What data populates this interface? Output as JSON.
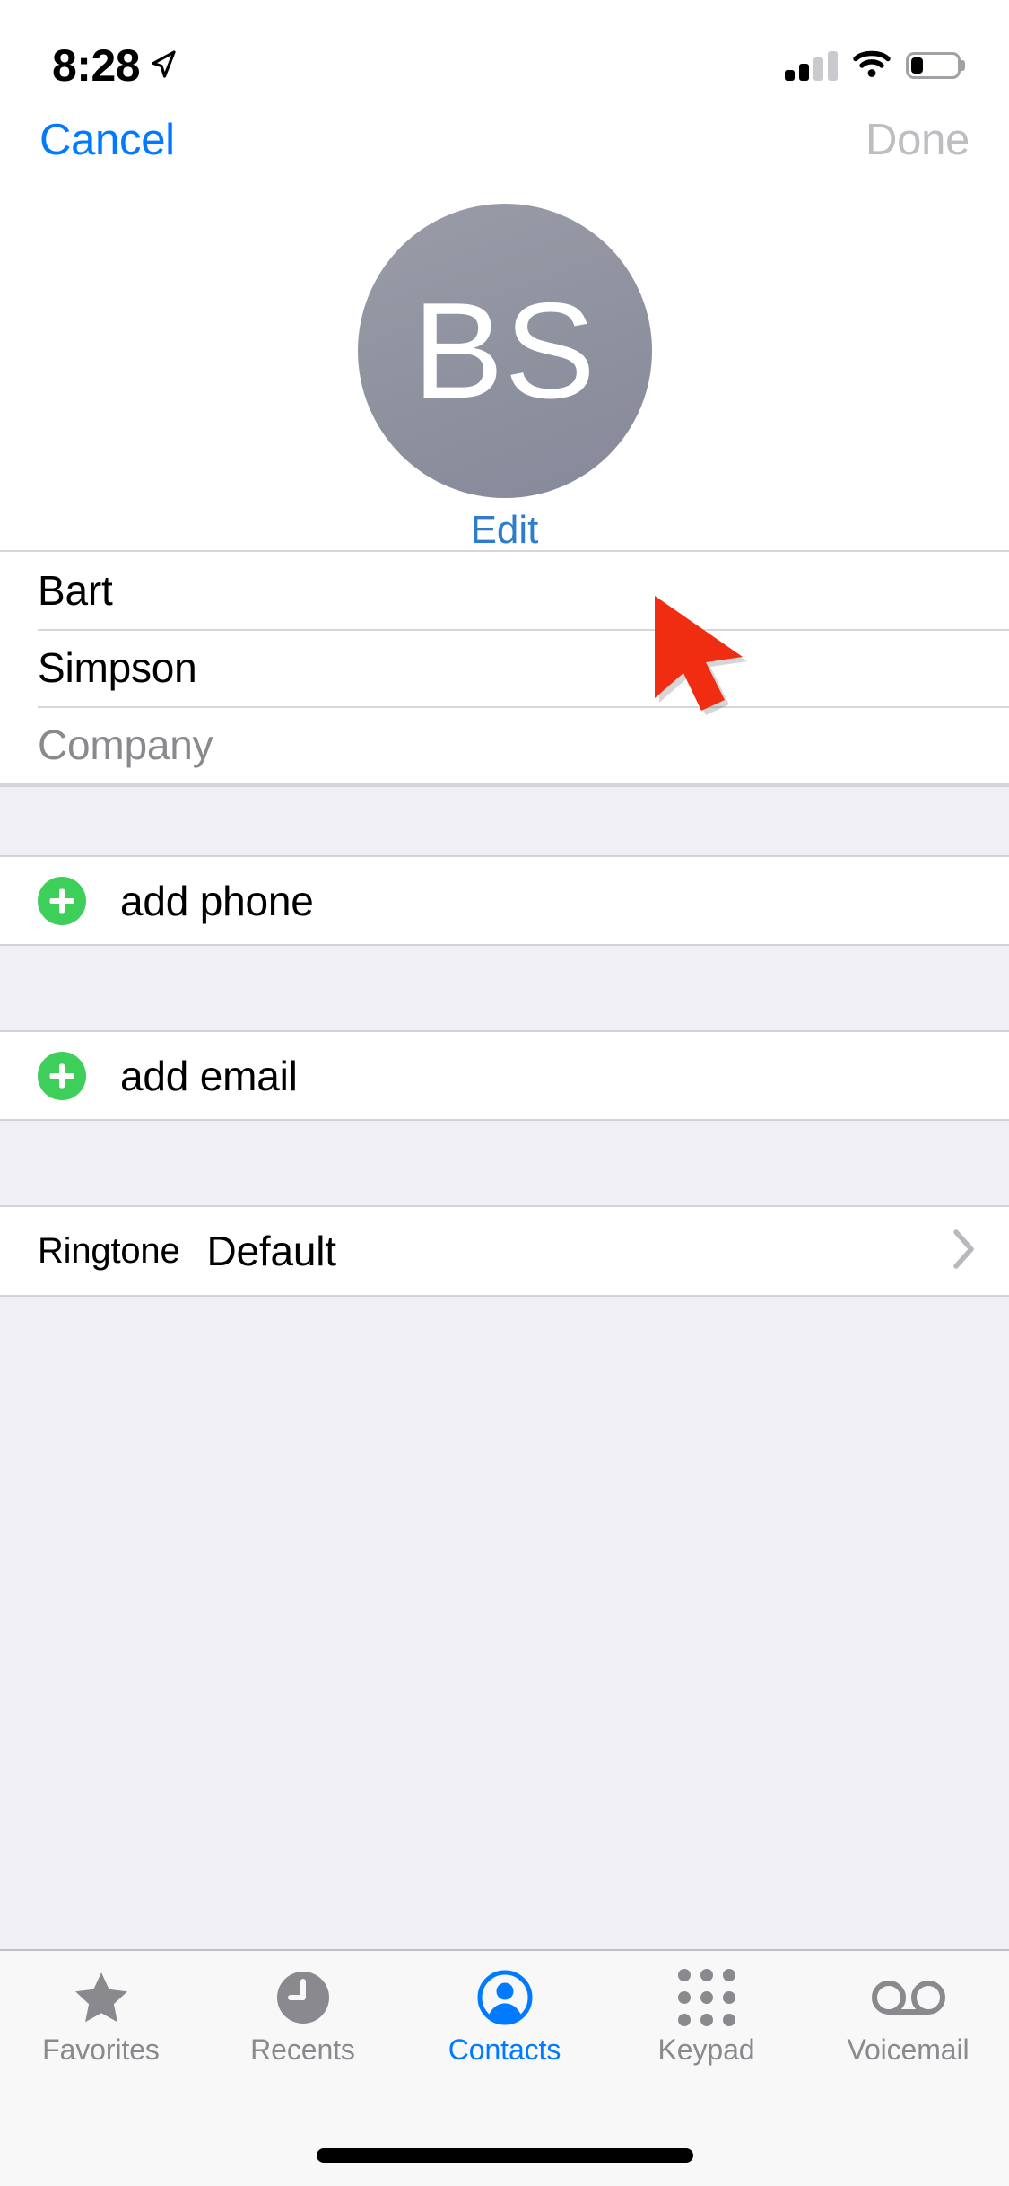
{
  "status_bar": {
    "time": "8:28",
    "location_icon": "location-arrow-icon",
    "signal_icon": "cellular-signal-icon",
    "signal_bars_filled": 2,
    "signal_bars_total": 4,
    "wifi_icon": "wifi-icon",
    "battery_icon": "battery-icon",
    "battery_percent": 26
  },
  "nav_bar": {
    "cancel_label": "Cancel",
    "done_label": "Done",
    "done_enabled": false,
    "cancel_color": "#007AFF",
    "done_color": "#BDBDC2"
  },
  "avatar": {
    "initials": "BS",
    "edit_label": "Edit",
    "background_color": "#8E919E",
    "edit_color": "#2E7CCC"
  },
  "cursor": {
    "icon": "mouse-pointer-icon",
    "color": "#F02D10"
  },
  "name_fields": [
    {
      "name": "first-name",
      "value": "Bart",
      "placeholder": "First name",
      "is_placeholder": false
    },
    {
      "name": "last-name",
      "value": "Simpson",
      "placeholder": "Last name",
      "is_placeholder": false
    },
    {
      "name": "company",
      "value": "Company",
      "placeholder": "Company",
      "is_placeholder": true
    }
  ],
  "add_rows": [
    {
      "name": "add-phone",
      "label": "add phone",
      "icon": "plus-circle-icon",
      "icon_color": "#3ECF5A"
    },
    {
      "name": "add-email",
      "label": "add email",
      "icon": "plus-circle-icon",
      "icon_color": "#3ECF5A"
    }
  ],
  "ringtone": {
    "label": "Ringtone",
    "value": "Default",
    "chevron_icon": "chevron-right-icon"
  },
  "tab_bar": {
    "items": [
      {
        "id": "favorites",
        "label": "Favorites",
        "icon": "star-icon",
        "active": false
      },
      {
        "id": "recents",
        "label": "Recents",
        "icon": "clock-icon",
        "active": false
      },
      {
        "id": "contacts",
        "label": "Contacts",
        "icon": "person-circle-icon",
        "active": true
      },
      {
        "id": "keypad",
        "label": "Keypad",
        "icon": "keypad-grid-icon",
        "active": false
      },
      {
        "id": "voicemail",
        "label": "Voicemail",
        "icon": "voicemail-icon",
        "active": false
      }
    ],
    "active_color": "#007AFF",
    "inactive_color": "#8A8A8E"
  },
  "home_indicator": {
    "name": "home-indicator"
  }
}
